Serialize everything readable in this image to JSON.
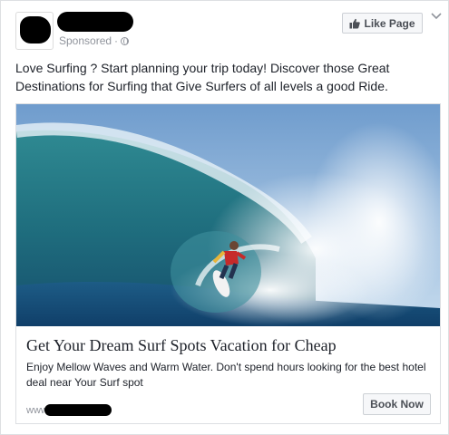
{
  "post": {
    "sponsored_label": "Sponsored",
    "like_button_label": "Like Page",
    "body_text": "Love Surfing ? Start planning your trip today! Discover those Great Destinations for Surfing that Give Surfers of all levels a good Ride."
  },
  "ad": {
    "headline": "Get Your Dream Surf Spots Vacation for Cheap",
    "description": "Enjoy Mellow Waves and Warm Water. Don't spend hours looking for the best hotel deal near Your Surf spot",
    "url_prefix": "www",
    "cta_label": "Book Now"
  },
  "icons": {
    "like": "thumbs-up-icon",
    "audience": "globe-icon",
    "menu": "chevron-down-icon"
  },
  "colors": {
    "text": "#1d2129",
    "secondary_text": "#90949c",
    "border": "#dddfe2",
    "button_bg": "#f6f7f9",
    "button_text": "#4b4f56"
  }
}
